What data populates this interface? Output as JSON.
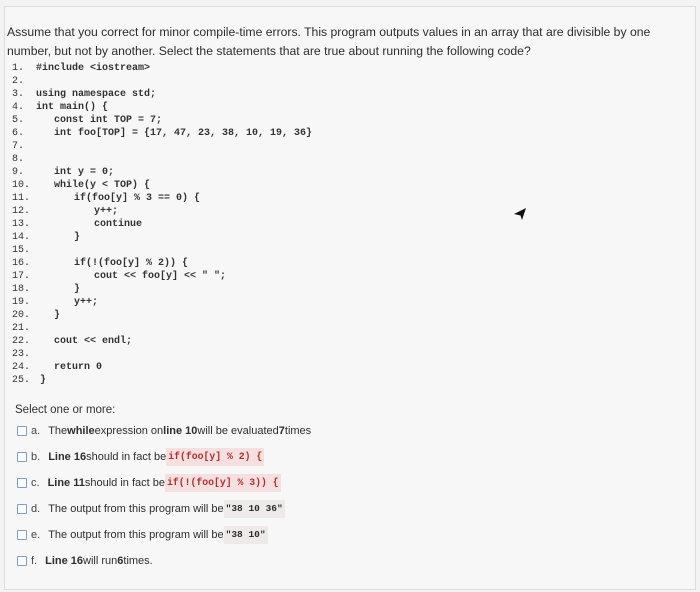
{
  "question": "Assume that you correct for minor compile-time errors. This program outputs values in an array that are divisible by one number, but not by another. Select the statements that are true about running the following code?",
  "code_lines": [
    {
      "n": "1.",
      "t": "#include <iostream>",
      "indent": 0
    },
    {
      "n": "2.",
      "t": "",
      "indent": 0
    },
    {
      "n": "3.",
      "t": "using namespace std;",
      "indent": 0
    },
    {
      "n": "4.",
      "t": "int main() {",
      "indent": 0
    },
    {
      "n": "5.",
      "t": "const int TOP = 7;",
      "indent": 3
    },
    {
      "n": "6.",
      "t": "int foo[TOP] = {17, 47, 23, 38, 10, 19, 36}",
      "indent": 3
    },
    {
      "n": "7.",
      "t": "",
      "indent": 0
    },
    {
      "n": "8.",
      "t": "",
      "indent": 0
    },
    {
      "n": "9.",
      "t": "int y = 0;",
      "indent": 3
    },
    {
      "n": "10.",
      "t": "while(y < TOP) {",
      "indent": 3
    },
    {
      "n": "11.",
      "t": "if(foo[y] % 3 == 0) {",
      "indent": 5
    },
    {
      "n": "12.",
      "t": "y++;",
      "indent": 7
    },
    {
      "n": "13.",
      "t": "continue",
      "indent": 7
    },
    {
      "n": "14.",
      "t": "}",
      "indent": 5
    },
    {
      "n": "15.",
      "t": "",
      "indent": 0
    },
    {
      "n": "16.",
      "t": "if(!(foo[y] % 2)) {",
      "indent": 5
    },
    {
      "n": "17.",
      "t": "cout << foo[y] << \" \";",
      "indent": 7
    },
    {
      "n": "18.",
      "t": "}",
      "indent": 5
    },
    {
      "n": "19.",
      "t": "y++;",
      "indent": 5
    },
    {
      "n": "20.",
      "t": "}",
      "indent": 3
    },
    {
      "n": "21.",
      "t": "",
      "indent": 0
    },
    {
      "n": "22.",
      "t": "cout << endl;",
      "indent": 3
    },
    {
      "n": "23.",
      "t": "",
      "indent": 0
    },
    {
      "n": "24.",
      "t": "return 0",
      "indent": 3
    },
    {
      "n": "25.",
      "t": "}",
      "indent": 1
    }
  ],
  "select_label": "Select one or more:",
  "options": {
    "a": {
      "letter": "a.",
      "pre": "The ",
      "kw1": "while",
      "mid": " expression on ",
      "kw2": "line 10",
      "post": " will be evaluated ",
      "kw3": "7",
      "end": " times"
    },
    "b": {
      "letter": "b.",
      "pre": "Line 16",
      "mid": " should in fact be ",
      "code": "if(foo[y] % 2) {"
    },
    "c": {
      "letter": "c.",
      "pre": "Line 11",
      "mid": " should in fact be ",
      "code": "if(!(foo[y] % 3)) {"
    },
    "d": {
      "letter": "d.",
      "pre": "The output from this program will be ",
      "code": "\"38 10 36\""
    },
    "e": {
      "letter": "e.",
      "pre": "The output from this program will be ",
      "code": "\"38 10\""
    },
    "f": {
      "letter": "f.",
      "pre": "Line 16",
      "mid": " will run ",
      "kw": "6",
      "post": " times."
    }
  }
}
